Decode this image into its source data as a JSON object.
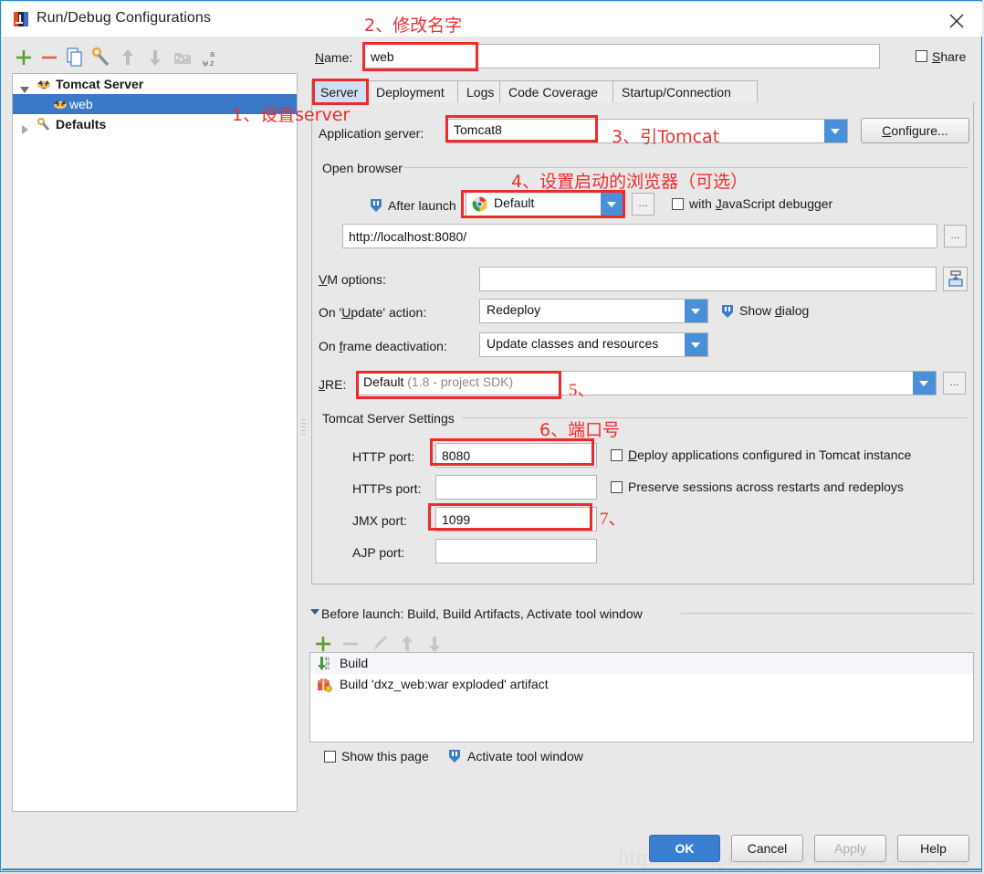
{
  "window": {
    "title": "Run/Debug Configurations",
    "icon": "intellij-idea-icon",
    "close_icon": "close-icon"
  },
  "left_panel": {
    "toolbar": [
      {
        "name": "add-button",
        "glyph": "+"
      },
      {
        "name": "remove-button",
        "glyph": "−"
      },
      {
        "name": "copy-configuration-button",
        "glyph": "copy-icon"
      },
      {
        "name": "edit-defaults-button",
        "glyph": "wrench-icon"
      },
      {
        "name": "move-up-button",
        "glyph": "arrow-up-icon"
      },
      {
        "name": "move-down-button",
        "glyph": "arrow-down-icon"
      },
      {
        "name": "move-into-folder-button",
        "glyph": "folder-icon"
      },
      {
        "name": "sort-configurations-button",
        "glyph": "sort-az-icon"
      }
    ],
    "tree": [
      {
        "label": "Tomcat Server",
        "icon": "tomcat-icon",
        "expanded": true,
        "bold": true,
        "selected": false,
        "indent": 0
      },
      {
        "label": "web",
        "icon": "tomcat-icon",
        "expanded": null,
        "bold": false,
        "selected": true,
        "indent": 1
      },
      {
        "label": "Defaults",
        "icon": "wrench-icon",
        "expanded": false,
        "bold": true,
        "selected": false,
        "indent": 0
      }
    ]
  },
  "name_row": {
    "label": "Name:",
    "value": "web",
    "share_label": "Share",
    "share_checked": false
  },
  "tabs": [
    {
      "label": "Server",
      "active": true
    },
    {
      "label": "Deployment",
      "active": false
    },
    {
      "label": "Logs",
      "active": false
    },
    {
      "label": "Code Coverage",
      "active": false
    },
    {
      "label": "Startup/Connection",
      "active": false
    }
  ],
  "server_tab": {
    "application_server": {
      "label": "Application server:",
      "value": "Tomcat8"
    },
    "configure_button": "Configure...",
    "open_browser": {
      "group_title": "Open browser",
      "after_launch_label": "After launch",
      "after_launch_checked": true,
      "browser": "Default",
      "browser_icon": "chrome-icon",
      "ellipsis": "...",
      "js_debugger_label": "with JavaScript debugger",
      "js_debugger_checked": false,
      "url": "http://localhost:8080/",
      "url_ellipsis": "..."
    },
    "vm_options": {
      "label": "VM options:",
      "value": "",
      "expand_icon": "expand-editor-icon"
    },
    "on_update_action": {
      "label": "On 'Update' action:",
      "value": "Redeploy",
      "show_dialog_label": "Show dialog",
      "show_dialog_icon": "idea-balloon-icon"
    },
    "on_frame_deactivation": {
      "label": "On frame deactivation:",
      "value": "Update classes and resources"
    },
    "jre": {
      "label": "JRE:",
      "value": "Default",
      "value_dim": " (1.8 - project SDK)",
      "ellipsis": "..."
    },
    "tomcat_settings": {
      "group_title": "Tomcat Server Settings",
      "http_port": {
        "label": "HTTP port:",
        "value": "8080"
      },
      "https_port": {
        "label": "HTTPs port:",
        "value": ""
      },
      "jmx_port": {
        "label": "JMX port:",
        "value": "1099"
      },
      "ajp_port": {
        "label": "AJP port:",
        "value": ""
      },
      "deploy_checkbox": {
        "label": "Deploy applications configured in Tomcat instance",
        "checked": false
      },
      "preserve_checkbox": {
        "label": "Preserve sessions across restarts and redeploys",
        "checked": false
      }
    }
  },
  "before_launch": {
    "title": "Before launch: Build, Build Artifacts, Activate tool window",
    "toolbar": [
      {
        "name": "add-task-button",
        "glyph": "+",
        "enabled": true
      },
      {
        "name": "remove-task-button",
        "glyph": "−",
        "enabled": false
      },
      {
        "name": "edit-task-button",
        "glyph": "pencil-icon",
        "enabled": false
      },
      {
        "name": "move-task-up-button",
        "glyph": "arrow-up-icon",
        "enabled": false
      },
      {
        "name": "move-task-down-button",
        "glyph": "arrow-down-icon",
        "enabled": false
      }
    ],
    "tasks": [
      {
        "label": "Build",
        "icon": "build-icon"
      },
      {
        "label": "Build 'dxz_web:war exploded' artifact",
        "icon": "artifact-icon"
      }
    ],
    "show_this_page": {
      "label": "Show this page",
      "checked": false
    },
    "activate_tool_window": {
      "label": "Activate tool window",
      "icon": "idea-balloon-icon",
      "checked": true
    }
  },
  "footer_buttons": [
    {
      "label": "OK",
      "primary": true,
      "enabled": true
    },
    {
      "label": "Cancel",
      "primary": false,
      "enabled": true
    },
    {
      "label": "Apply",
      "primary": false,
      "enabled": false
    },
    {
      "label": "Help",
      "primary": false,
      "enabled": true
    }
  ],
  "annotations": [
    {
      "id": "a1",
      "text": "1、设置server"
    },
    {
      "id": "a2",
      "text": "2、修改名字"
    },
    {
      "id": "a3",
      "text": "3、引Tomcat"
    },
    {
      "id": "a4",
      "text": "4、设置启动的浏览器（可选）"
    },
    {
      "id": "a5",
      "text": "5、"
    },
    {
      "id": "a6",
      "text": "6、端口号"
    },
    {
      "id": "a7",
      "text": "7、"
    }
  ],
  "watermark": "https://blog.csdn.net/wm13322597721",
  "colors": {
    "accent": "#1f8ad2",
    "selection": "#3a78c8",
    "annotation_red": "#ee2b2b",
    "combo_arrow": "#4a90d9",
    "tab_active": "#cfe0f2"
  }
}
